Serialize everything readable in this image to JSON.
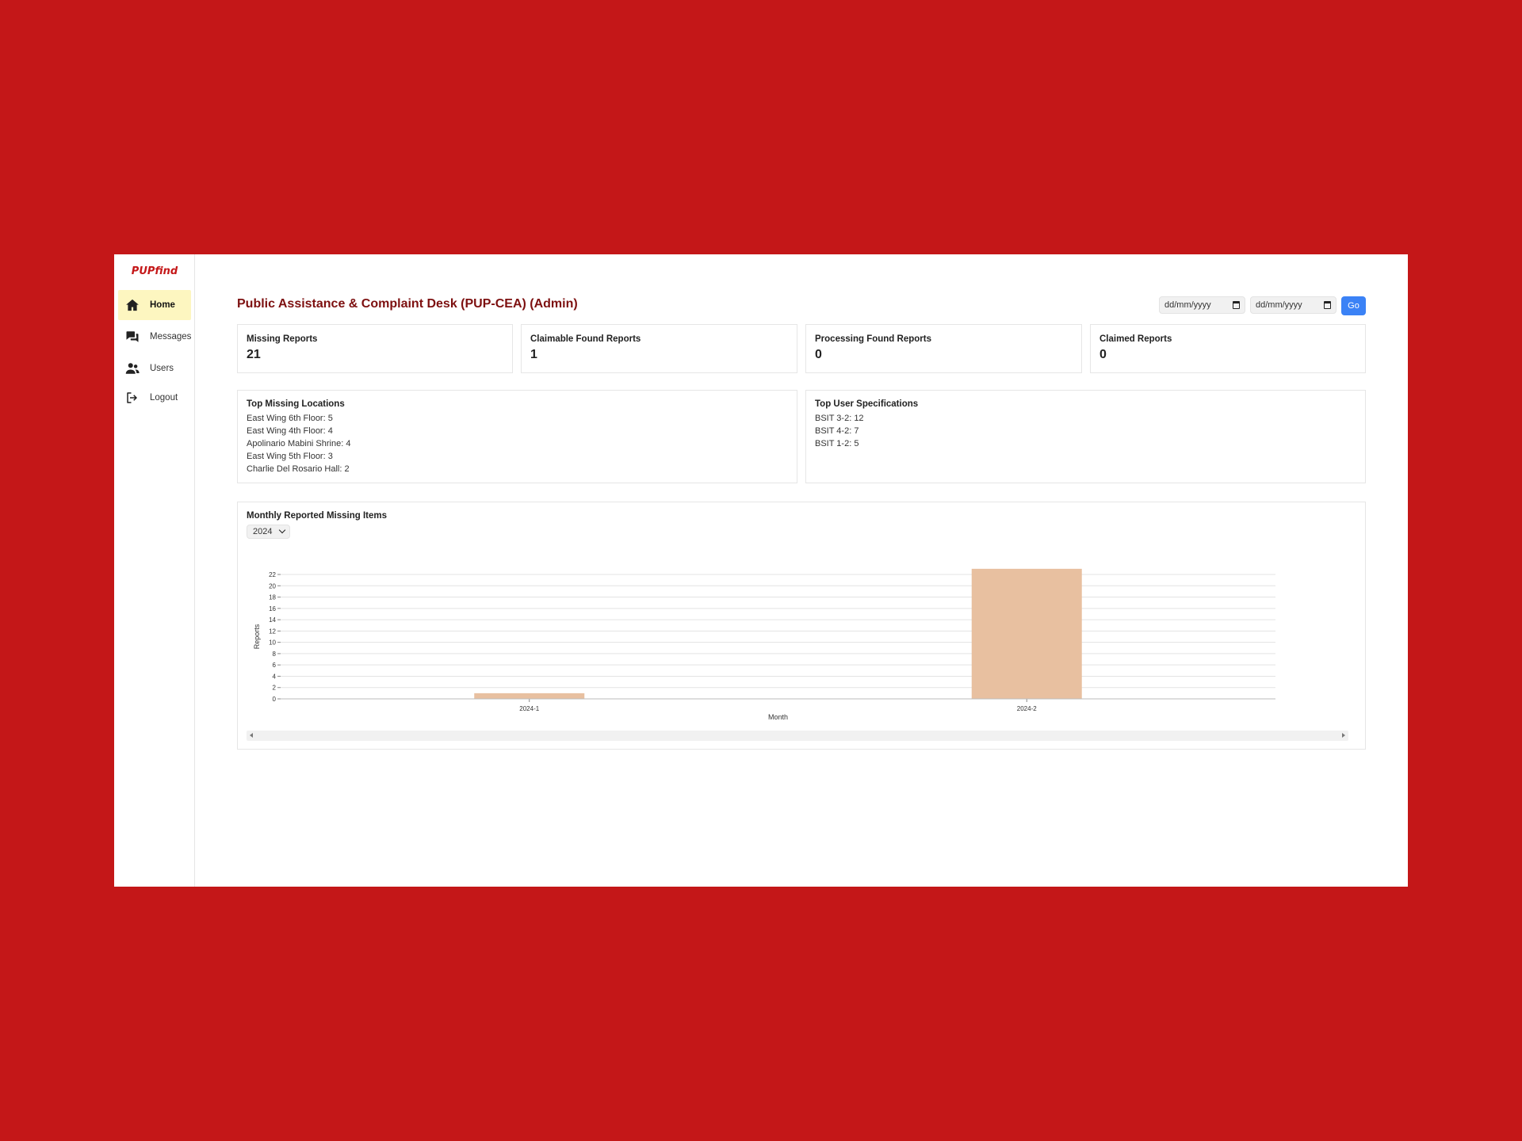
{
  "app": {
    "logo_text": "PUPfind"
  },
  "sidebar": {
    "items": [
      {
        "label": "Home",
        "icon": "home-icon"
      },
      {
        "label": "Messages",
        "icon": "messages-icon"
      },
      {
        "label": "Users",
        "icon": "users-icon"
      },
      {
        "label": "Logout",
        "icon": "logout-icon"
      }
    ],
    "active_color": "#fdf6c0"
  },
  "header": {
    "title": "Public Assistance & Complaint Desk (PUP-CEA) (Admin)",
    "start_date_placeholder": "dd/mm/yyyy",
    "end_date_placeholder": "dd/mm/yyyy",
    "go_label": "Go"
  },
  "stats": [
    {
      "title": "Missing Reports",
      "value": "21"
    },
    {
      "title": "Claimable Found Reports",
      "value": "1"
    },
    {
      "title": "Processing Found Reports",
      "value": "0"
    },
    {
      "title": "Claimed Reports",
      "value": "0"
    }
  ],
  "top_locations": {
    "title": "Top Missing Locations",
    "items": [
      "East Wing 6th Floor: 5",
      "East Wing 4th Floor: 4",
      "Apolinario Mabini Shrine: 4",
      "East Wing 5th Floor: 3",
      "Charlie Del Rosario Hall: 2"
    ]
  },
  "top_specs": {
    "title": "Top User Specifications",
    "items": [
      "BSIT 3-2: 12",
      "BSIT 4-2: 7",
      "BSIT 1-2: 5"
    ]
  },
  "chart_panel": {
    "title": "Monthly Reported Missing Items",
    "year": "2024"
  },
  "chart_data": {
    "type": "bar",
    "categories": [
      "2024-1",
      "2024-2"
    ],
    "values": [
      1,
      23
    ],
    "xlabel": "Month",
    "ylabel": "Reports",
    "ylim": [
      0,
      22
    ],
    "yticks": [
      0,
      2,
      4,
      6,
      8,
      10,
      12,
      14,
      16,
      18,
      20,
      22
    ],
    "bar_color": "#e8c0a0",
    "grid": true
  },
  "colors": {
    "background": "#c41718",
    "title": "#7d1010",
    "button": "#3b82f6"
  }
}
